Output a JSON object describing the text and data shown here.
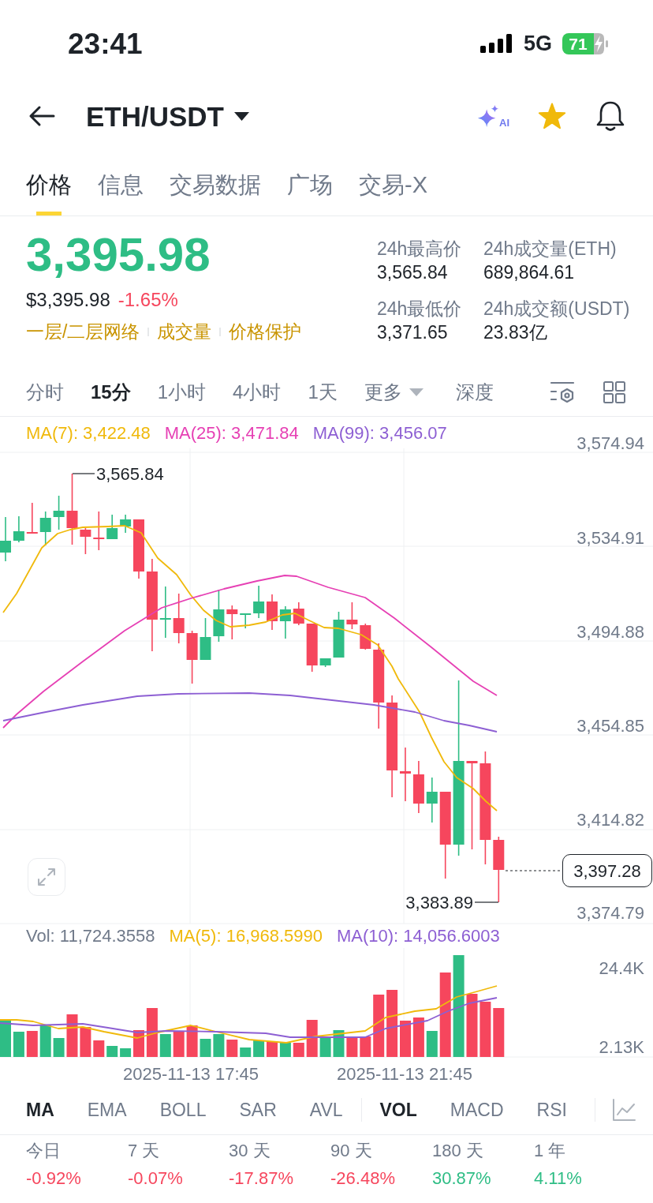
{
  "status_bar": {
    "time": "23:41",
    "network": "5G",
    "battery": "71"
  },
  "header": {
    "pair": "ETH/USDT",
    "ai_label": "AI",
    "favorite": true
  },
  "tabs": [
    {
      "label": "价格",
      "selected": true
    },
    {
      "label": "信息",
      "selected": false
    },
    {
      "label": "交易数据",
      "selected": false
    },
    {
      "label": "广场",
      "selected": false
    },
    {
      "label": "交易-X",
      "selected": false
    }
  ],
  "price": {
    "last": "3,395.98",
    "last_rising": true,
    "usd": "$3,395.98",
    "change": "-1.65%",
    "change_rising": false,
    "links": [
      "一层/二层网络",
      "成交量",
      "价格保护"
    ]
  },
  "stats": [
    {
      "label": "24h最高价",
      "value": "3,565.84"
    },
    {
      "label": "24h成交量(ETH)",
      "value": "689,864.61"
    },
    {
      "label": "24h最低价",
      "value": "3,371.65"
    },
    {
      "label": "24h成交额(USDT)",
      "value": "23.83亿"
    }
  ],
  "intervals": [
    {
      "label": "分时",
      "selected": false
    },
    {
      "label": "15分",
      "selected": true
    },
    {
      "label": "1小时",
      "selected": false
    },
    {
      "label": "4小时",
      "selected": false
    },
    {
      "label": "1天",
      "selected": false
    }
  ],
  "more_menu": {
    "label": "更多"
  },
  "depth_tab": {
    "label": "深度"
  },
  "chart": {
    "ma_legend": [
      {
        "label": "MA(7): 3,422.48",
        "color": "#f0b90b"
      },
      {
        "label": "MA(25): 3,471.84",
        "color": "#e640b4"
      },
      {
        "label": "MA(99): 3,456.07",
        "color": "#8d5fd3"
      }
    ],
    "y_axis": [
      "3,574.94",
      "3,534.91",
      "3,494.88",
      "3,454.85",
      "3,414.82",
      "3,374.79"
    ],
    "high_marker": "3,565.84",
    "low_marker": "3,383.89",
    "last_price": "3,397.28"
  },
  "volume": {
    "legend": [
      {
        "label": "Vol: 11,724.3558",
        "color": "#707a8a"
      },
      {
        "label": "MA(5): 16,968.5990",
        "color": "#f0b90b"
      },
      {
        "label": "MA(10): 14,056.6003",
        "color": "#8d5fd3"
      }
    ],
    "y_axis": [
      "24.4K",
      "2.13K"
    ]
  },
  "x_axis": [
    "2025-11-13 17:45",
    "2025-11-13 21:45"
  ],
  "main_indicators": [
    {
      "label": "MA",
      "selected": true
    },
    {
      "label": "EMA",
      "selected": false
    },
    {
      "label": "BOLL",
      "selected": false
    },
    {
      "label": "SAR",
      "selected": false
    },
    {
      "label": "AVL",
      "selected": false
    }
  ],
  "sub_indicators": [
    {
      "label": "VOL",
      "selected": true
    },
    {
      "label": "MACD",
      "selected": false
    },
    {
      "label": "RSI",
      "selected": false
    }
  ],
  "performance": [
    {
      "period": "今日",
      "change": "-0.92%",
      "rising": false
    },
    {
      "period": "7 天",
      "change": "-0.07%",
      "rising": false
    },
    {
      "period": "30 天",
      "change": "-17.87%",
      "rising": false
    },
    {
      "period": "90 天",
      "change": "-26.48%",
      "rising": false
    },
    {
      "period": "180 天",
      "change": "30.87%",
      "rising": true
    },
    {
      "period": "1 年",
      "change": "4.11%",
      "rising": true
    }
  ]
}
